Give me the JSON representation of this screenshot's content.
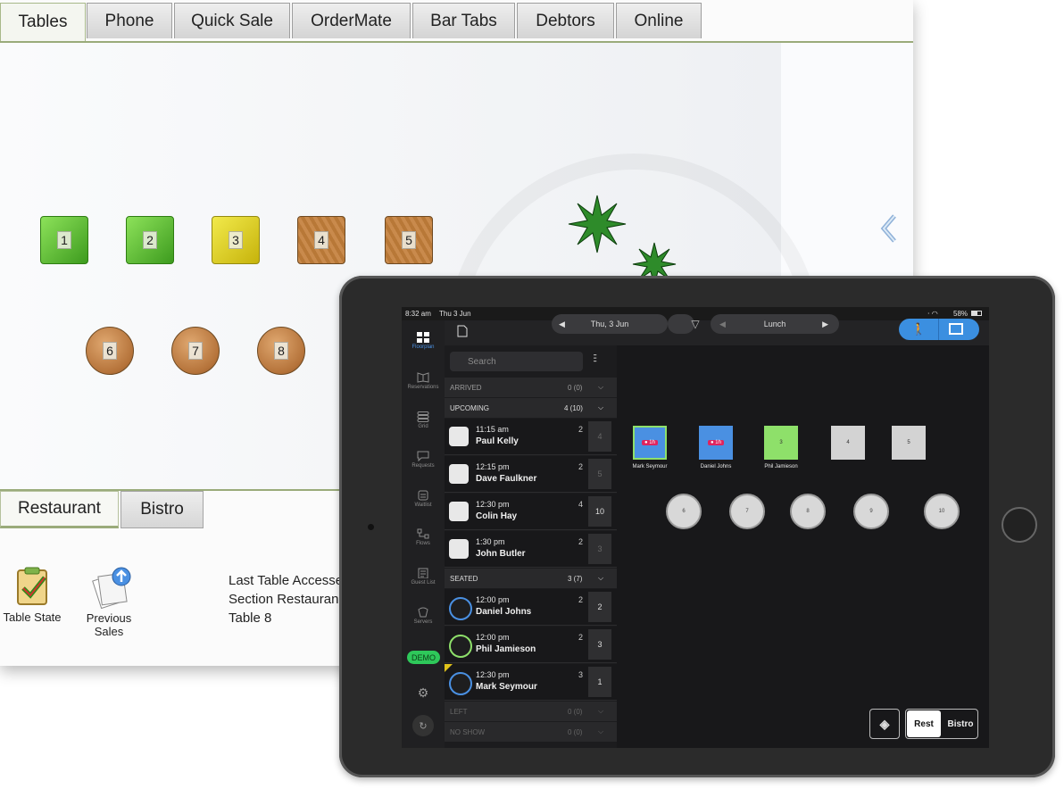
{
  "pos": {
    "tabs": [
      {
        "label": "Tables"
      },
      {
        "label": "Phone"
      },
      {
        "label": "Quick Sale"
      },
      {
        "label": "OrderMate"
      },
      {
        "label": "Bar Tabs"
      },
      {
        "label": "Debtors"
      },
      {
        "label": "Online"
      }
    ],
    "tables": [
      {
        "label": "1",
        "state": "green"
      },
      {
        "label": "2",
        "state": "green"
      },
      {
        "label": "3",
        "state": "yellow"
      },
      {
        "label": "4",
        "state": "wood"
      },
      {
        "label": "5",
        "state": "wood"
      },
      {
        "label": "6"
      },
      {
        "label": "7"
      },
      {
        "label": "8"
      }
    ],
    "section_tabs": [
      {
        "label": "Restaurant"
      },
      {
        "label": "Bistro"
      }
    ],
    "tools": [
      {
        "label": "Table State"
      },
      {
        "label": "Previous Sales"
      }
    ],
    "info_lines": [
      "Last Table Accesse",
      "Section Restauran",
      "Table 8"
    ]
  },
  "ipad": {
    "status": {
      "time": "8:32 am",
      "date": "Thu 3 Jun",
      "battery": "58%"
    },
    "toolbar": {
      "date": "Thu, 3 Jun",
      "shift": "Lunch"
    },
    "nav": [
      "Floorplan",
      "Reservations",
      "Grid",
      "Requests",
      "Waitlist",
      "Flows",
      "Guest List",
      "Servers"
    ],
    "demo_badge": "DEMO",
    "search_placeholder": "Search",
    "sections": [
      {
        "label": "ARRIVED",
        "count": "0 (0)"
      },
      {
        "label": "UPCOMING",
        "count": "4 (10)"
      },
      {
        "label": "SEATED",
        "count": "3 (7)"
      },
      {
        "label": "LEFT",
        "count": "0 (0)"
      },
      {
        "label": "NO SHOW",
        "count": "0 (0)"
      }
    ],
    "upcoming": [
      {
        "time": "11:15 am",
        "name": "Paul Kelly",
        "covers": "2",
        "table": "4"
      },
      {
        "time": "12:15 pm",
        "name": "Dave Faulkner",
        "covers": "2",
        "table": "5"
      },
      {
        "time": "12:30 pm",
        "name": "Colin Hay",
        "covers": "4",
        "table": "10"
      },
      {
        "time": "1:30 pm",
        "name": "John Butler",
        "covers": "2",
        "table": "3"
      }
    ],
    "seated": [
      {
        "time": "12:00 pm",
        "name": "Daniel Johns",
        "covers": "2",
        "table": "2"
      },
      {
        "time": "12:00 pm",
        "name": "Phil Jamieson",
        "covers": "2",
        "table": "3"
      },
      {
        "time": "12:30 pm",
        "name": "Mark Seymour",
        "covers": "3",
        "table": "1"
      }
    ],
    "floor_tables": [
      {
        "label": "",
        "guest": "Mark Seymour",
        "color": "#4a90e2"
      },
      {
        "label": "",
        "guest": "Daniel Johns",
        "color": "#4a90e2"
      },
      {
        "label": "3",
        "guest": "Phil Jamieson",
        "color": "#8ee06a"
      },
      {
        "label": "4",
        "guest": ""
      },
      {
        "label": "5",
        "guest": ""
      },
      {
        "label": "6"
      },
      {
        "label": "7"
      },
      {
        "label": "8"
      },
      {
        "label": "9"
      },
      {
        "label": "10"
      }
    ],
    "segments": [
      {
        "label": "Rest"
      },
      {
        "label": "Bistro"
      }
    ]
  }
}
